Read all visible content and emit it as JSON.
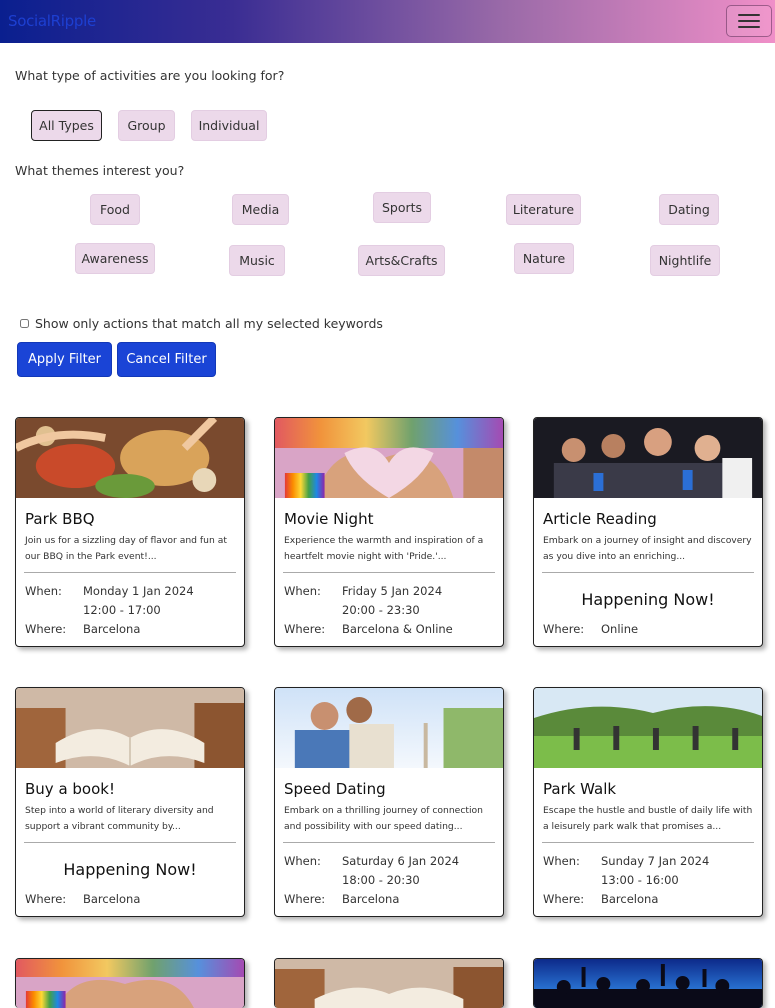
{
  "header": {
    "brand": "SocialRipple"
  },
  "filters": {
    "type_question": "What type of activities are you looking for?",
    "types": [
      "All Types",
      "Group",
      "Individual"
    ],
    "theme_question": "What themes interest you?",
    "themes": [
      "Food",
      "Media",
      "Sports",
      "Literature",
      "Dating",
      "Awareness",
      "Music",
      "Arts&Crafts",
      "Nature",
      "Nightlife"
    ],
    "match_all_label": "Show only actions that match all my selected keywords",
    "apply_label": "Apply Filter",
    "cancel_label": "Cancel Filter"
  },
  "labels": {
    "when": "When:",
    "where": "Where:",
    "now": "Happening Now!"
  },
  "cards": [
    {
      "title": "Park BBQ",
      "desc": "Join us for a sizzling day of flavor and fun at our BBQ in the Park event!...",
      "date": "Monday 1 Jan 2024",
      "time": "12:00 - 17:00",
      "place": "Barcelona"
    },
    {
      "title": "Movie Night",
      "desc": "Experience the warmth and inspiration of a heartfelt movie night with 'Pride.'...",
      "date": "Friday 5 Jan 2024",
      "time": "20:00 - 23:30",
      "place": "Barcelona & Online"
    },
    {
      "title": "Article Reading",
      "desc": "Embark on a journey of insight and discovery as you dive into an enriching...",
      "place": "Online"
    },
    {
      "title": "Buy a book!",
      "desc": "Step into a world of literary diversity and support a vibrant community by...",
      "place": "Barcelona"
    },
    {
      "title": "Speed Dating",
      "desc": "Embark on a thrilling journey of connection and possibility with our speed dating...",
      "date": "Saturday 6 Jan 2024",
      "time": "18:00 - 20:30",
      "place": "Barcelona"
    },
    {
      "title": "Park Walk",
      "desc": "Escape the hustle and bustle of daily life with a leisurely park walk that promises a...",
      "date": "Sunday 7 Jan 2024",
      "time": "13:00 - 16:00",
      "place": "Barcelona"
    }
  ]
}
